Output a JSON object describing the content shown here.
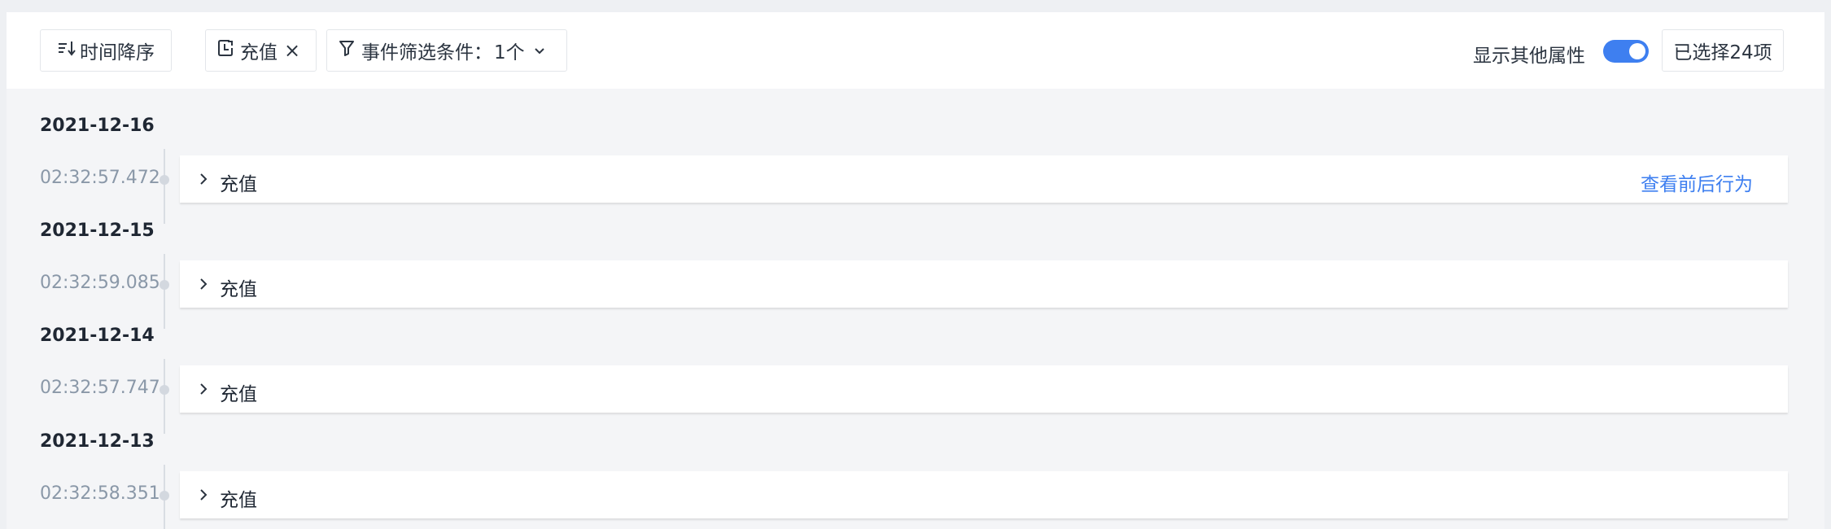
{
  "toolbar": {
    "sort_label": "时间降序",
    "event_tag": "充值",
    "event_tag_close": "×",
    "filter_label": "事件筛选条件：",
    "filter_count": "1个",
    "show_other_attrs_label": "显示其他属性",
    "show_other_attrs_on": true,
    "selected_label": "已选择24项"
  },
  "accent_color": "#3e7ff0",
  "timeline": [
    {
      "date": "2021-12-16",
      "time": "02:32:57.472",
      "event": "充值",
      "action": "查看前后行为"
    },
    {
      "date": "2021-12-15",
      "time": "02:32:59.085",
      "event": "充值"
    },
    {
      "date": "2021-12-14",
      "time": "02:32:57.747",
      "event": "充值"
    },
    {
      "date": "2021-12-13",
      "time": "02:32:58.351",
      "event": "充值"
    }
  ]
}
